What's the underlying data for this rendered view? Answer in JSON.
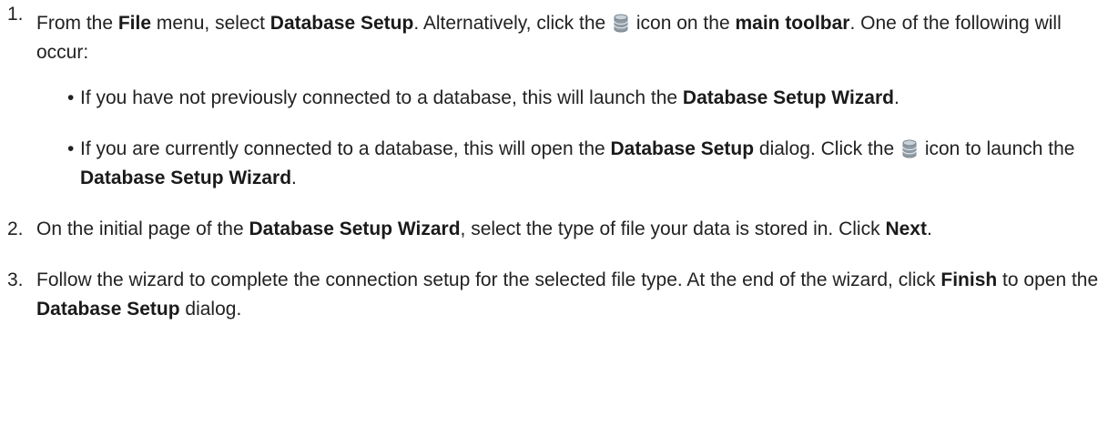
{
  "steps": [
    {
      "number": "1.",
      "t1": "From the ",
      "b1": "File",
      "t2": " menu, select ",
      "b2": "Database Setup",
      "t3": ". Alternatively, click the ",
      "icon": "database-icon",
      "t4": " icon on the ",
      "b3": "main toolbar",
      "t5": ". One of the following will occur:",
      "bullets": [
        {
          "t1": "If you have not previously connected to a database, this will launch the ",
          "b1": "Database Setup Wizard",
          "t2": "."
        },
        {
          "t1": "If you are currently connected to a database, this will open the ",
          "b1": "Database Setup",
          "t2": " dialog. Click the ",
          "icon": "database-icon",
          "t3": " icon to launch the ",
          "b2": "Database Setup Wizard",
          "t4": "."
        }
      ]
    },
    {
      "number": "2.",
      "t1": "On the initial page of the ",
      "b1": "Database Setup Wizard",
      "t2": ", select the type of file your data is stored in. Click ",
      "b2": "Next",
      "t3": "."
    },
    {
      "number": "3.",
      "t1": "Follow the wizard to complete the connection setup for the selected file type. At the end of the wizard, click ",
      "b1": "Finish",
      "t2": " to open the ",
      "b2": "Database Setup",
      "t3": " dialog."
    }
  ],
  "colors": {
    "text": "#222222",
    "icon_body": "#8f9aa3",
    "icon_highlight": "#c9d2d9"
  }
}
